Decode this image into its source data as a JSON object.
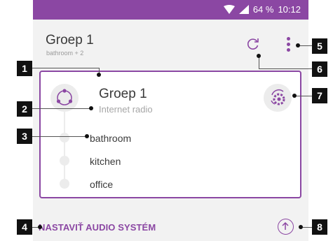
{
  "status_bar": {
    "battery": "64 %",
    "time": "10:12",
    "wifi_icon": "wifi-icon",
    "signal_icon": "signal-icon"
  },
  "header": {
    "title": "Groep 1",
    "subtitle": "bathroom + 2",
    "refresh_icon": "refresh-icon",
    "menu_icon": "kebab-menu-icon"
  },
  "group_card": {
    "title": "Groep 1",
    "source": "Internet radio",
    "rooms": [
      "bathroom",
      "kitchen",
      "office"
    ],
    "group_icon": "group-icon",
    "settings_icon": "speaker-settings-icon"
  },
  "footer": {
    "setup_link": "NASTAVIŤ AUDIO SYSTÉM",
    "up_icon": "arrow-up-icon"
  },
  "callouts": [
    "1",
    "2",
    "3",
    "4",
    "5",
    "6",
    "7",
    "8"
  ],
  "colors": {
    "accent": "#8b47a3",
    "background": "#f2f2f2",
    "card": "#ffffff",
    "callout": "#111111"
  }
}
